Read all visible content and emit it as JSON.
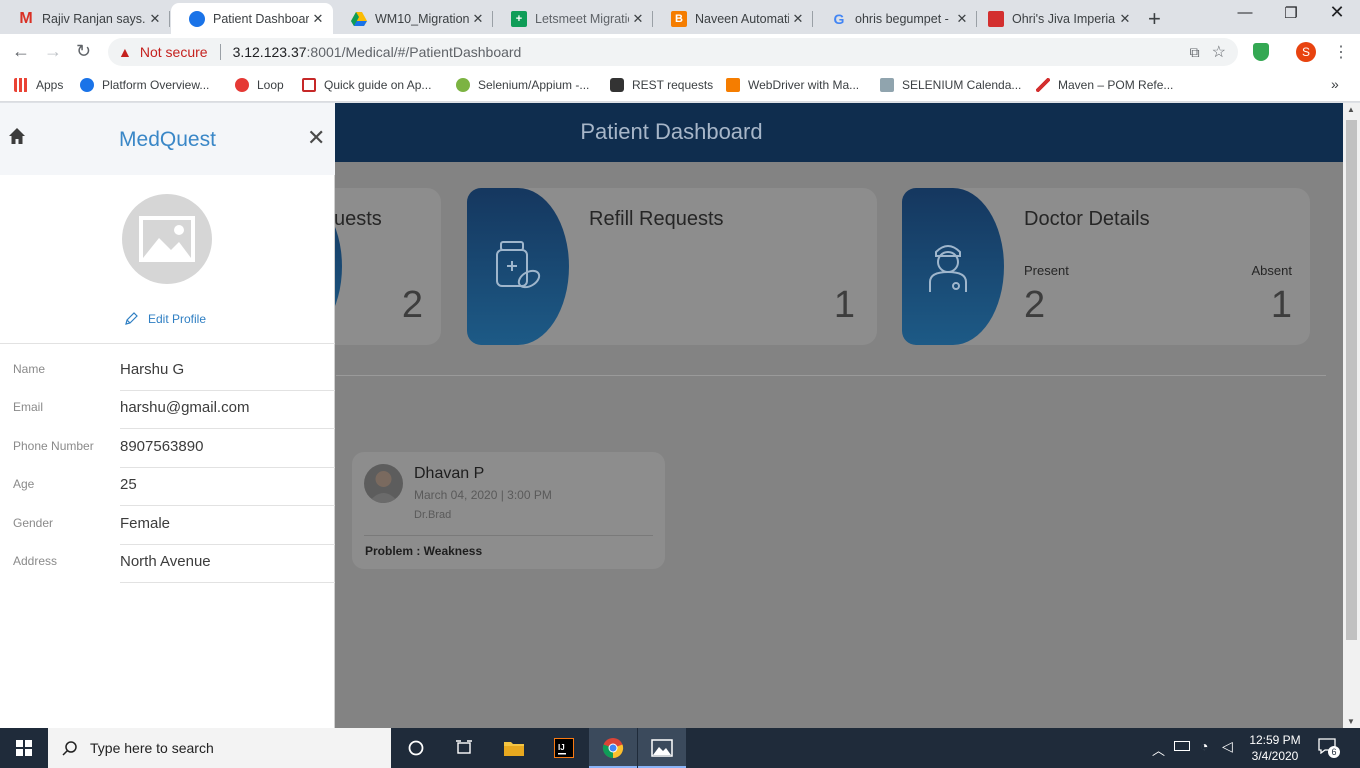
{
  "browser": {
    "tabs": [
      {
        "title": "Rajiv Ranjan says...",
        "favicon": "gmail-icon",
        "active": false
      },
      {
        "title": "Patient Dashboard",
        "favicon": "medquest-icon",
        "active": true
      },
      {
        "title": "WM10_Migration",
        "favicon": "drive-icon",
        "active": false
      },
      {
        "title": "Letsmeet Migratio",
        "favicon": "sheets-icon",
        "active": false
      },
      {
        "title": "Naveen Automatio",
        "favicon": "blogger-icon",
        "active": false
      },
      {
        "title": "ohris begumpet - ",
        "favicon": "google-icon",
        "active": false
      },
      {
        "title": "Ohri's Jiva Imperia",
        "favicon": "site-icon",
        "active": false
      }
    ],
    "security_label": "Not secure",
    "url_host": "3.12.123.37",
    "url_path": ":8001/Medical/#/PatientDashboard",
    "profile_initial": "S",
    "bookmarks": [
      {
        "label": "Apps"
      },
      {
        "label": "Platform Overview..."
      },
      {
        "label": "Loop"
      },
      {
        "label": "Quick guide on Ap..."
      },
      {
        "label": "Selenium/Appium -..."
      },
      {
        "label": "REST requests"
      },
      {
        "label": "WebDriver with Ma..."
      },
      {
        "label": "SELENIUM Calenda..."
      },
      {
        "label": "Maven – POM Refe..."
      }
    ],
    "bookmarks_overflow": "»"
  },
  "app": {
    "header_title": "Patient Dashboard",
    "cards": [
      {
        "title": "uests",
        "count": "2"
      },
      {
        "title": "Refill Requests",
        "count": "1"
      },
      {
        "title": "Doctor Details",
        "present_label": "Present",
        "present": "2",
        "absent_label": "Absent",
        "absent": "1"
      }
    ],
    "appointment": {
      "name": "Dhavan P",
      "datetime": "March 04, 2020 | 3:00 PM",
      "doctor": "Dr.Brad",
      "problem": "Problem : Weakness"
    }
  },
  "panel": {
    "brand": "MedQuest",
    "close": "✕",
    "edit_profile": "Edit Profile",
    "fields": [
      {
        "label": "Name",
        "value": "Harshu G"
      },
      {
        "label": "Email",
        "value": "harshu@gmail.com"
      },
      {
        "label": "Phone Number",
        "value": "8907563890"
      },
      {
        "label": "Age",
        "value": "25"
      },
      {
        "label": "Gender",
        "value": "Female"
      },
      {
        "label": "Address",
        "value": "North Avenue"
      }
    ]
  },
  "taskbar": {
    "search_placeholder": "Type here to search",
    "time": "12:59 PM",
    "date": "3/4/2020",
    "notification_count": "6"
  },
  "colors": {
    "brand": "#3a87c7",
    "header": "#0f2d4e",
    "accent_band": "#1d5a86",
    "overlay": "#838383"
  }
}
